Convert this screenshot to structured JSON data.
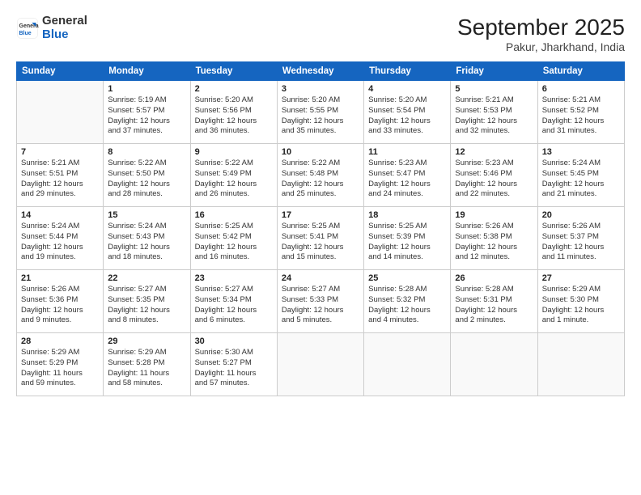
{
  "header": {
    "logo_general": "General",
    "logo_blue": "Blue",
    "month": "September 2025",
    "location": "Pakur, Jharkhand, India"
  },
  "weekdays": [
    "Sunday",
    "Monday",
    "Tuesday",
    "Wednesday",
    "Thursday",
    "Friday",
    "Saturday"
  ],
  "weeks": [
    [
      {
        "day": "",
        "info": ""
      },
      {
        "day": "1",
        "info": "Sunrise: 5:19 AM\nSunset: 5:57 PM\nDaylight: 12 hours\nand 37 minutes."
      },
      {
        "day": "2",
        "info": "Sunrise: 5:20 AM\nSunset: 5:56 PM\nDaylight: 12 hours\nand 36 minutes."
      },
      {
        "day": "3",
        "info": "Sunrise: 5:20 AM\nSunset: 5:55 PM\nDaylight: 12 hours\nand 35 minutes."
      },
      {
        "day": "4",
        "info": "Sunrise: 5:20 AM\nSunset: 5:54 PM\nDaylight: 12 hours\nand 33 minutes."
      },
      {
        "day": "5",
        "info": "Sunrise: 5:21 AM\nSunset: 5:53 PM\nDaylight: 12 hours\nand 32 minutes."
      },
      {
        "day": "6",
        "info": "Sunrise: 5:21 AM\nSunset: 5:52 PM\nDaylight: 12 hours\nand 31 minutes."
      }
    ],
    [
      {
        "day": "7",
        "info": "Sunrise: 5:21 AM\nSunset: 5:51 PM\nDaylight: 12 hours\nand 29 minutes."
      },
      {
        "day": "8",
        "info": "Sunrise: 5:22 AM\nSunset: 5:50 PM\nDaylight: 12 hours\nand 28 minutes."
      },
      {
        "day": "9",
        "info": "Sunrise: 5:22 AM\nSunset: 5:49 PM\nDaylight: 12 hours\nand 26 minutes."
      },
      {
        "day": "10",
        "info": "Sunrise: 5:22 AM\nSunset: 5:48 PM\nDaylight: 12 hours\nand 25 minutes."
      },
      {
        "day": "11",
        "info": "Sunrise: 5:23 AM\nSunset: 5:47 PM\nDaylight: 12 hours\nand 24 minutes."
      },
      {
        "day": "12",
        "info": "Sunrise: 5:23 AM\nSunset: 5:46 PM\nDaylight: 12 hours\nand 22 minutes."
      },
      {
        "day": "13",
        "info": "Sunrise: 5:24 AM\nSunset: 5:45 PM\nDaylight: 12 hours\nand 21 minutes."
      }
    ],
    [
      {
        "day": "14",
        "info": "Sunrise: 5:24 AM\nSunset: 5:44 PM\nDaylight: 12 hours\nand 19 minutes."
      },
      {
        "day": "15",
        "info": "Sunrise: 5:24 AM\nSunset: 5:43 PM\nDaylight: 12 hours\nand 18 minutes."
      },
      {
        "day": "16",
        "info": "Sunrise: 5:25 AM\nSunset: 5:42 PM\nDaylight: 12 hours\nand 16 minutes."
      },
      {
        "day": "17",
        "info": "Sunrise: 5:25 AM\nSunset: 5:41 PM\nDaylight: 12 hours\nand 15 minutes."
      },
      {
        "day": "18",
        "info": "Sunrise: 5:25 AM\nSunset: 5:39 PM\nDaylight: 12 hours\nand 14 minutes."
      },
      {
        "day": "19",
        "info": "Sunrise: 5:26 AM\nSunset: 5:38 PM\nDaylight: 12 hours\nand 12 minutes."
      },
      {
        "day": "20",
        "info": "Sunrise: 5:26 AM\nSunset: 5:37 PM\nDaylight: 12 hours\nand 11 minutes."
      }
    ],
    [
      {
        "day": "21",
        "info": "Sunrise: 5:26 AM\nSunset: 5:36 PM\nDaylight: 12 hours\nand 9 minutes."
      },
      {
        "day": "22",
        "info": "Sunrise: 5:27 AM\nSunset: 5:35 PM\nDaylight: 12 hours\nand 8 minutes."
      },
      {
        "day": "23",
        "info": "Sunrise: 5:27 AM\nSunset: 5:34 PM\nDaylight: 12 hours\nand 6 minutes."
      },
      {
        "day": "24",
        "info": "Sunrise: 5:27 AM\nSunset: 5:33 PM\nDaylight: 12 hours\nand 5 minutes."
      },
      {
        "day": "25",
        "info": "Sunrise: 5:28 AM\nSunset: 5:32 PM\nDaylight: 12 hours\nand 4 minutes."
      },
      {
        "day": "26",
        "info": "Sunrise: 5:28 AM\nSunset: 5:31 PM\nDaylight: 12 hours\nand 2 minutes."
      },
      {
        "day": "27",
        "info": "Sunrise: 5:29 AM\nSunset: 5:30 PM\nDaylight: 12 hours\nand 1 minute."
      }
    ],
    [
      {
        "day": "28",
        "info": "Sunrise: 5:29 AM\nSunset: 5:29 PM\nDaylight: 11 hours\nand 59 minutes."
      },
      {
        "day": "29",
        "info": "Sunrise: 5:29 AM\nSunset: 5:28 PM\nDaylight: 11 hours\nand 58 minutes."
      },
      {
        "day": "30",
        "info": "Sunrise: 5:30 AM\nSunset: 5:27 PM\nDaylight: 11 hours\nand 57 minutes."
      },
      {
        "day": "",
        "info": ""
      },
      {
        "day": "",
        "info": ""
      },
      {
        "day": "",
        "info": ""
      },
      {
        "day": "",
        "info": ""
      }
    ]
  ]
}
